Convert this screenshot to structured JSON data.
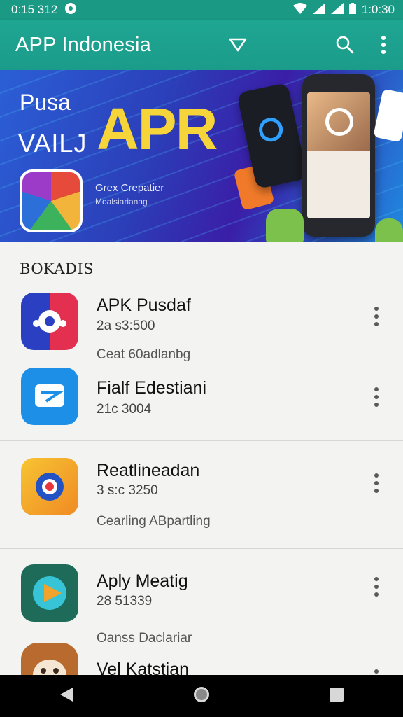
{
  "status": {
    "time_left": "0:15 312",
    "time_right": "1:0:30",
    "colors": {
      "bar": "#1a9985"
    }
  },
  "appbar": {
    "title": "APP Indonesia",
    "icons": [
      "filter-icon",
      "search-icon",
      "more-vert-icon"
    ]
  },
  "banner": {
    "line1": "Pusa",
    "line2": "VAILJ",
    "big": "APR",
    "sub_a": "Grex Crepatier",
    "sub_b": "Moalsiarianag"
  },
  "section": {
    "title": "BOKADIS"
  },
  "apps": [
    {
      "name": "APK Pusdaf",
      "meta": "2a s3:500",
      "desc": "Ceat 60adlanbg"
    },
    {
      "name": "Fialf Edestiani",
      "meta": "21c 3004",
      "desc": ""
    },
    {
      "name": "Reatlineadan",
      "meta": "3 s:c 3250",
      "desc": "Cearling ABpartling"
    },
    {
      "name": "Aply Meatig",
      "meta": "28 51339",
      "desc": "Oanss Daclariar"
    },
    {
      "name": "Vel Katstian",
      "meta": "",
      "desc": ""
    }
  ],
  "navbar": {
    "icons": [
      "back-icon",
      "home-icon",
      "recents-icon"
    ]
  }
}
